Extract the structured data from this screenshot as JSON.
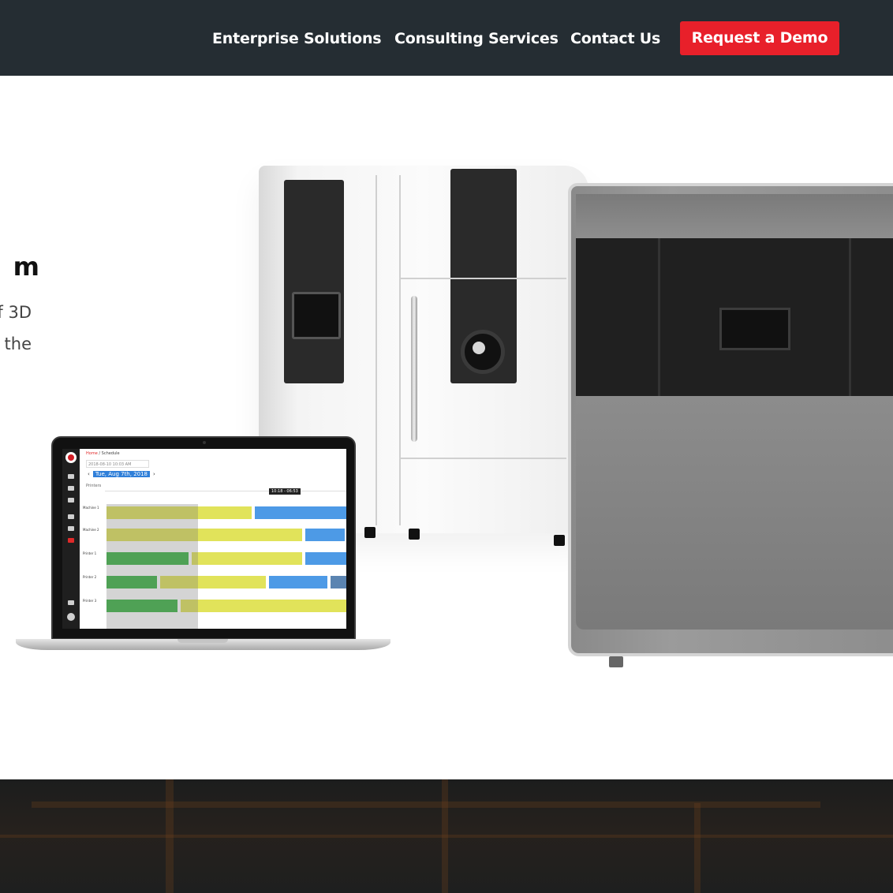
{
  "nav": {
    "links": [
      "Enterprise Solutions",
      "Consulting Services",
      "Contact Us"
    ],
    "cta": "Request a Demo"
  },
  "hero": {
    "title_fragment": "m",
    "line1_fragment": "f 3D",
    "line2_fragment": "n the"
  },
  "laptop_app": {
    "breadcrumb_home": "Home",
    "breadcrumb_sep": " / ",
    "breadcrumb_page": "Schedule",
    "search_text": "2018-08-10 10:03 AM",
    "prev": "‹",
    "next": "›",
    "date": "Tue, Aug 7th, 2018",
    "row_header": "Printers",
    "tooltip": "10:18 - 06:53",
    "rows": [
      "Machine 1",
      "Machine 2",
      "Printer 1",
      "Printer 2",
      "Printer 3"
    ]
  },
  "colors": {
    "header_bg": "#252d33",
    "cta_bg": "#e8202a",
    "gantt_green": "#3cb444",
    "gantt_yellow": "#e1e35a",
    "gantt_blue": "#4d9ae6"
  }
}
